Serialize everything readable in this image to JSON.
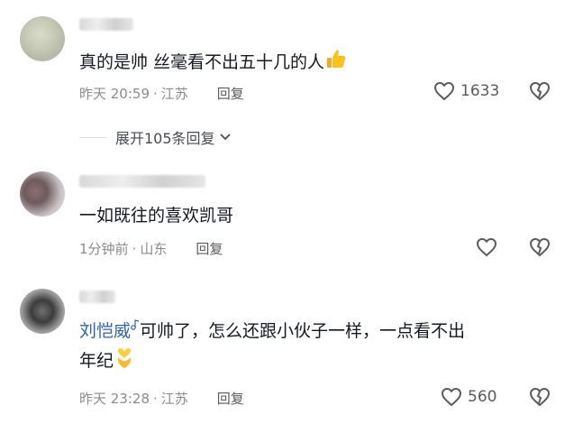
{
  "comments": [
    {
      "text": "真的是帅 丝毫看不出五十几的人",
      "time": "昨天 20:59",
      "location": "江苏",
      "reply_label": "回复",
      "likes": "1633"
    },
    {
      "text": "一如既往的喜欢凯哥",
      "time": "1分钟前",
      "location": "山东",
      "reply_label": "回复",
      "likes": ""
    },
    {
      "mention": "刘恺威",
      "text_line1": "可帅了，怎么还跟小伙子一样，一点看不出",
      "text_line2": "年纪",
      "time": "昨天 23:28",
      "location": "江苏",
      "reply_label": "回复",
      "likes": "560"
    }
  ],
  "expand_replies": {
    "label": "展开105条回复"
  },
  "colors": {
    "text": "#161823",
    "meta": "#8a8b91",
    "mention": "#2e64a8"
  }
}
